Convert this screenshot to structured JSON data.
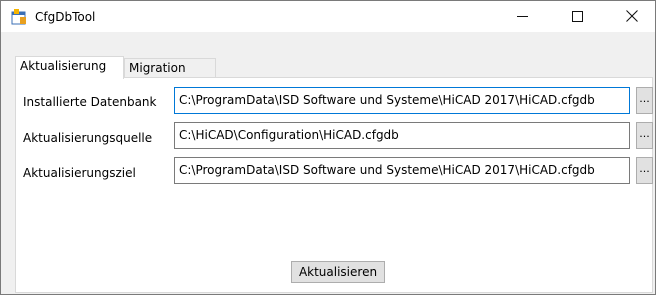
{
  "window": {
    "title": "CfgDbTool"
  },
  "tabs": [
    {
      "label": "Aktualisierung",
      "active": true
    },
    {
      "label": "Migration",
      "active": false
    }
  ],
  "fields": [
    {
      "label": "Installierte Datenbank",
      "value": "C:\\ProgramData\\ISD Software und Systeme\\HiCAD 2017\\HiCAD.cfgdb",
      "browse_label": "..."
    },
    {
      "label": "Aktualisierungsquelle",
      "value": "C:\\HiCAD\\Configuration\\HiCAD.cfgdb",
      "browse_label": "..."
    },
    {
      "label": "Aktualisierungsziel",
      "value": "C:\\ProgramData\\ISD Software und Systeme\\HiCAD 2017\\HiCAD.cfgdb",
      "browse_label": "..."
    }
  ],
  "actions": {
    "update_label": "Aktualisieren"
  },
  "icons": {
    "app": "app-window-icon",
    "minimize": "minimize-icon",
    "maximize": "maximize-icon",
    "close": "close-icon"
  },
  "colors": {
    "focus_border": "#0078d7",
    "window_bg": "#f0f0f0"
  }
}
